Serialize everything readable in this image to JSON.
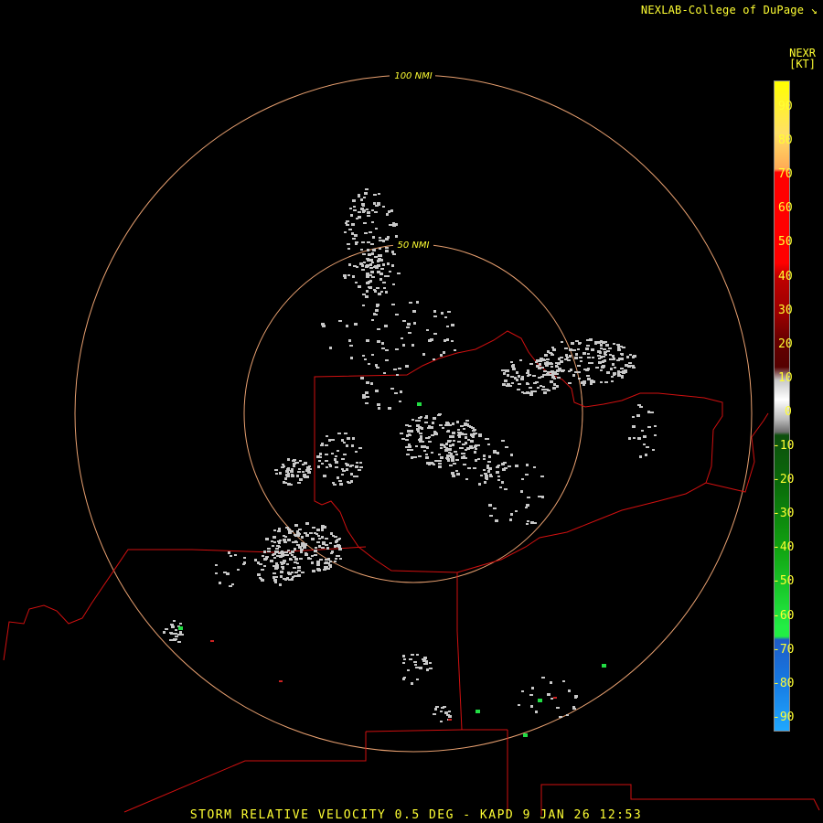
{
  "brand": {
    "text": "NEXLAB-College of DuPage",
    "icon": "logo-corner-glyph"
  },
  "legend": {
    "product": "NEXR",
    "units": "[KT]",
    "ticks": [
      "90",
      "80",
      "70",
      "60",
      "50",
      "40",
      "30",
      "20",
      "10",
      "0",
      "-10",
      "-20",
      "-30",
      "-40",
      "-50",
      "-60",
      "-70",
      "-80",
      "-90"
    ]
  },
  "range_rings": [
    "100 NMI",
    "50 NMI"
  ],
  "caption": "STORM RELATIVE VELOCITY 0.5 DEG - KAPD 9 JAN 26 12:53",
  "colors": {
    "background": "#000000",
    "text": "#ffff33",
    "ring": "#e8a070",
    "border": "#d01010",
    "echo": "#c8c8c8"
  }
}
